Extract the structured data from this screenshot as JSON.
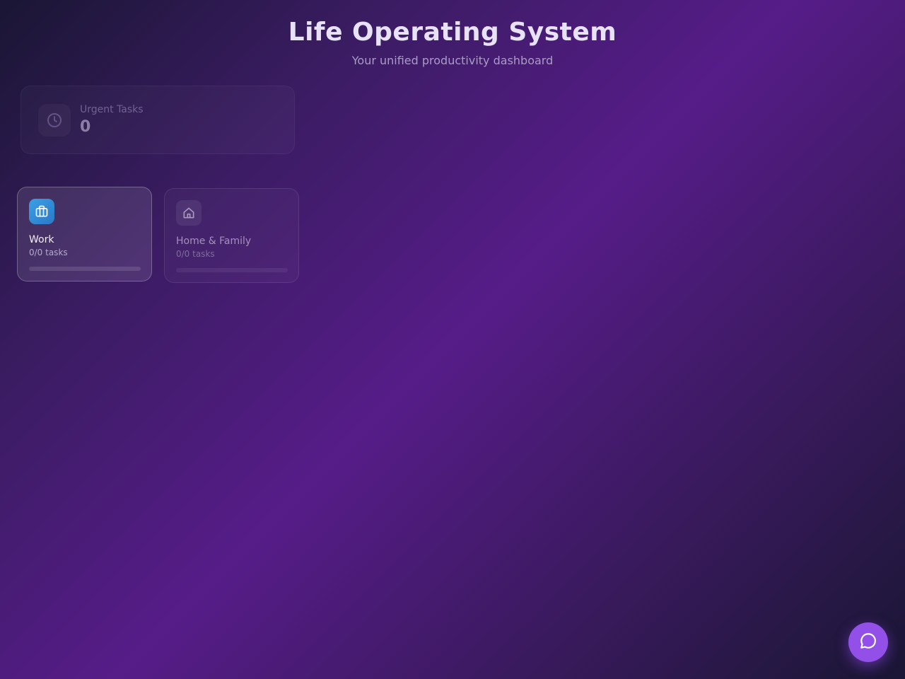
{
  "header": {
    "title": "Life Operating System",
    "subtitle": "Your unified productivity dashboard"
  },
  "stats": [
    {
      "label": "Urgent Tasks",
      "value": "0",
      "icon": "clock-icon"
    }
  ],
  "areas": [
    {
      "name": "Work",
      "count_text": "0/0 tasks",
      "icon": "briefcase-icon",
      "color": "#2f8fd8",
      "progress": 0
    },
    {
      "name": "Home & Family",
      "count_text": "0/0 tasks",
      "icon": "home-icon",
      "color": "#8b8497",
      "progress": 0
    }
  ],
  "chat": {
    "icon": "chat-bubble-icon",
    "color": "#9250e8"
  }
}
